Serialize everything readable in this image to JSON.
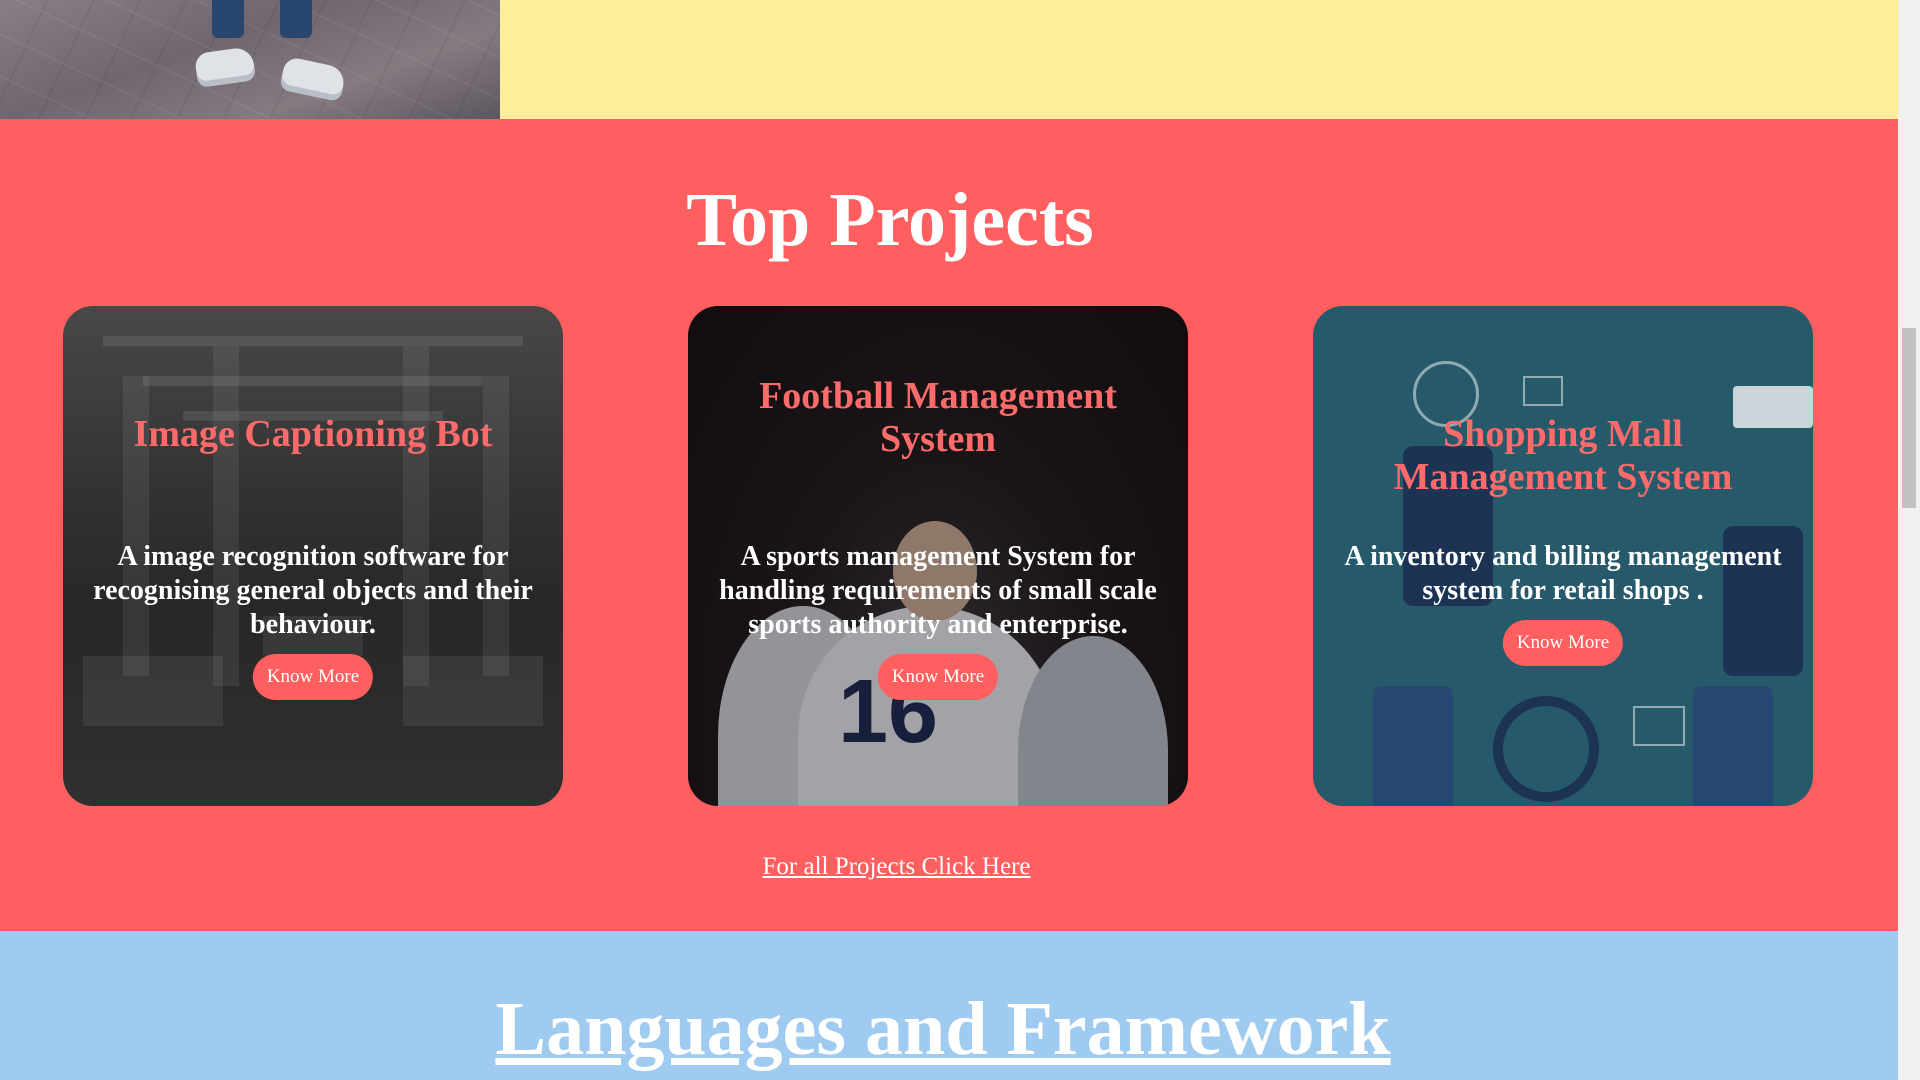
{
  "top_strip": {
    "background_color": "#ffee99"
  },
  "projects": {
    "background_color": "#ff5f5f",
    "title": "Top Projects",
    "cards": [
      {
        "title": "Image Captioning Bot",
        "description": "A image recognition software for recognising general objects and their behaviour.",
        "button_label": "Know More",
        "background_theme": "office interior"
      },
      {
        "title": "Football Management System",
        "description": "A sports management System for handling requirements of small scale sports authority and enterprise.",
        "button_label": "Know More",
        "background_theme": "football player"
      },
      {
        "title": "Shopping Mall Management System",
        "description": "A inventory and billing management system for retail shops .",
        "button_label": "Know More",
        "background_theme": "mobile commerce icons"
      }
    ],
    "jersey_number": "16",
    "all_projects_link": "For all Projects Click Here"
  },
  "languages": {
    "background_color": "#a0cbf0",
    "title": "Languages and Framework"
  },
  "colors": {
    "card_title": "#ff6b6b",
    "button_bg": "#ff5f5f",
    "text_white": "#ffffff"
  }
}
